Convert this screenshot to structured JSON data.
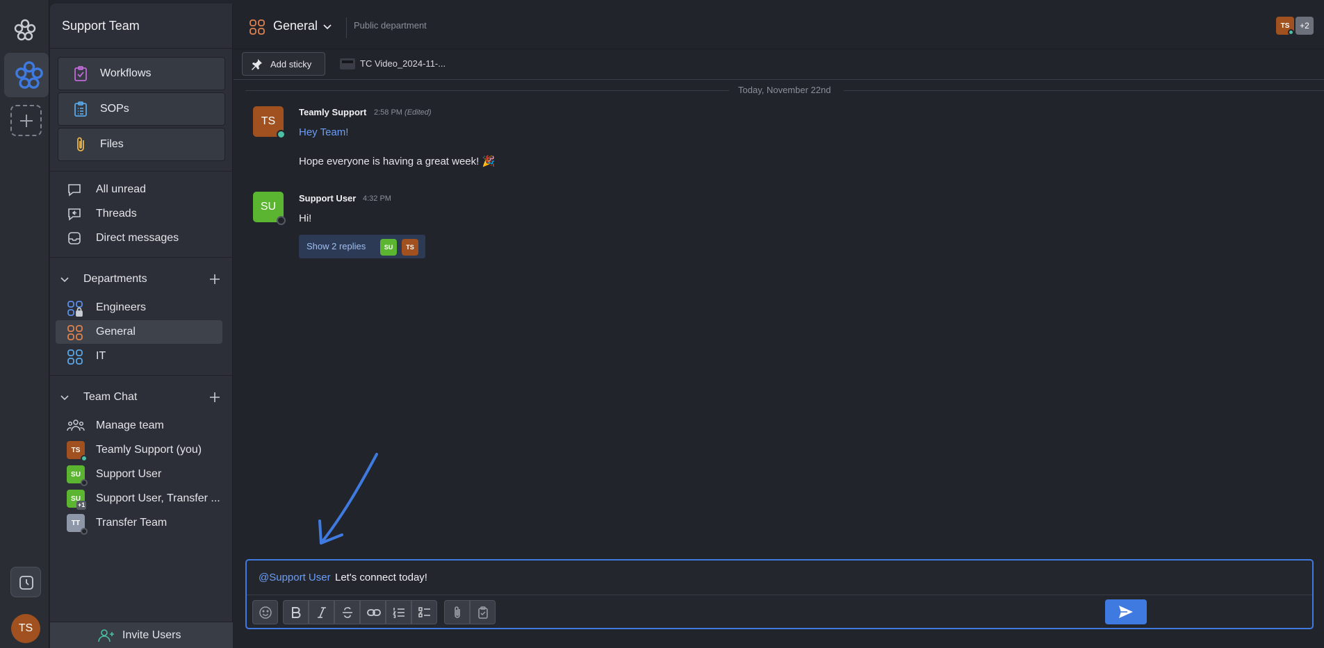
{
  "workspace": {
    "name": "Support Team",
    "user_initials": "TS"
  },
  "sidebar": {
    "cards": [
      {
        "label": "Workflows"
      },
      {
        "label": "SOPs"
      },
      {
        "label": "Files"
      }
    ],
    "nav": [
      {
        "label": "All unread"
      },
      {
        "label": "Threads"
      },
      {
        "label": "Direct messages"
      }
    ],
    "departments": {
      "label": "Departments",
      "items": [
        {
          "label": "Engineers"
        },
        {
          "label": "General"
        },
        {
          "label": "IT"
        }
      ]
    },
    "team_chat": {
      "label": "Team Chat",
      "items": [
        {
          "label": "Manage team"
        },
        {
          "label": "Teamly Support (you)",
          "initials": "TS"
        },
        {
          "label": "Support User",
          "initials": "SU"
        },
        {
          "label": "Support User, Transfer ...",
          "initials": "SU",
          "extra": "+1"
        },
        {
          "label": "Transfer Team",
          "initials": "TT"
        }
      ]
    },
    "invite_label": "Invite Users"
  },
  "header": {
    "title": "General",
    "subtitle": "Public department",
    "member_initials": "TS",
    "member_extra": "+2"
  },
  "toolbar": {
    "sticky_label": "Add sticky",
    "video_label": "TC Video_2024-11-..."
  },
  "date_divider": "Today, November 22nd",
  "messages": [
    {
      "initials": "TS",
      "author": "Teamly Support",
      "time": "2:58 PM",
      "edited": "(Edited)",
      "line1": "Hey Team!",
      "line2": "Hope everyone is having a great week! 🎉"
    },
    {
      "initials": "SU",
      "author": "Support User",
      "time": "4:32 PM",
      "line1": "Hi!",
      "replies_label": "Show 2 replies",
      "reply_initials": [
        "SU",
        "TS"
      ]
    }
  ],
  "composer": {
    "mention": "@Support User",
    "text": "Let's connect today!"
  },
  "colors": {
    "accent": "#3f7ae0",
    "ts_avatar": "#a0511f",
    "su_avatar": "#5cb531",
    "tt_avatar": "#8e97a8"
  }
}
